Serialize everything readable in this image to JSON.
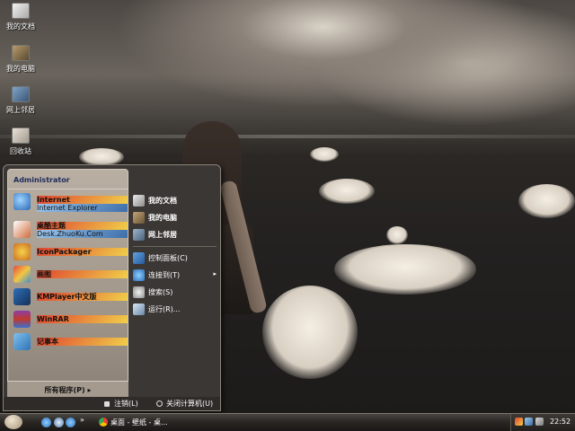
{
  "desktop": {
    "icons": [
      {
        "label": "我的文档",
        "icon": "my-documents-icon"
      },
      {
        "label": "我的电脑",
        "icon": "my-computer-icon"
      },
      {
        "label": "网上邻居",
        "icon": "network-places-icon"
      },
      {
        "label": "回收站",
        "icon": "recycle-bin-icon"
      }
    ]
  },
  "start_menu": {
    "user": "Administrator",
    "pinned": [
      {
        "title": "Internet",
        "subtitle": "Internet Explorer",
        "icon": "internet-explorer-icon"
      },
      {
        "title": "桌酷主题",
        "subtitle": "Desk.ZhuoKu.Com",
        "icon": "theme-icon"
      }
    ],
    "programs": [
      {
        "label": "IconPackager",
        "icon": "iconpackager-icon"
      },
      {
        "label": "画图",
        "icon": "paint-icon"
      },
      {
        "label": "KMPlayer中文版",
        "icon": "kmplayer-icon"
      },
      {
        "label": "WinRAR",
        "icon": "winrar-icon"
      },
      {
        "label": "记事本",
        "icon": "notepad-icon"
      }
    ],
    "all_programs": "所有程序(P)",
    "all_programs_arrow": "▸",
    "places": [
      {
        "label": "我的文档",
        "icon": "my-documents-icon"
      },
      {
        "label": "我的电脑",
        "icon": "my-computer-icon"
      },
      {
        "label": "网上邻居",
        "icon": "network-places-icon"
      }
    ],
    "system": [
      {
        "label": "控制面板(C)",
        "icon": "control-panel-icon"
      },
      {
        "label": "连接到(T)",
        "icon": "connect-to-icon",
        "arrow": "▸"
      },
      {
        "label": "搜索(S)",
        "icon": "search-icon"
      },
      {
        "label": "运行(R)...",
        "icon": "run-icon"
      }
    ],
    "logoff": "注销(L)",
    "shutdown": "关闭计算机(U)"
  },
  "taskbar": {
    "quicklaunch_more": "»",
    "window_title": "桌面 - 壁纸 - 桌...",
    "clock": "22:52"
  },
  "colors": {
    "menu_user_text": "#1f2d5c",
    "taskbar_bg": "#2a2724"
  }
}
